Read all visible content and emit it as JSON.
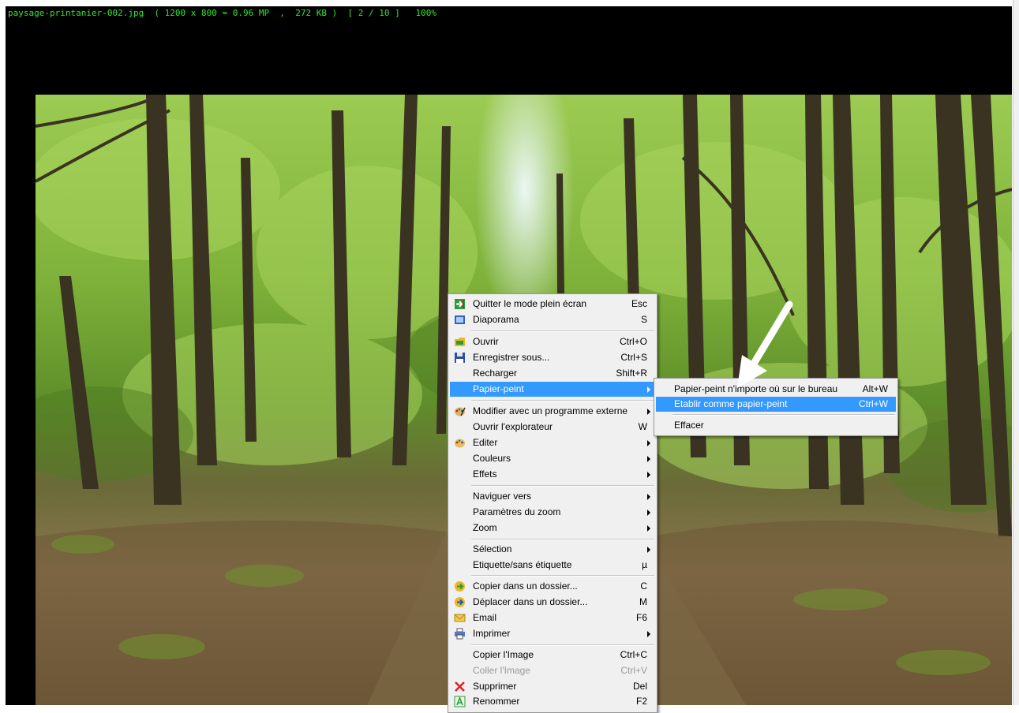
{
  "viewer": {
    "status_line": "paysage-printanier-002.jpg  ( 1200 x 800 = 0.96 MP  ,  272 KB )  [ 2 / 10 ]   100%"
  },
  "context_menu": {
    "items": [
      {
        "label": "Quitter le mode plein écran",
        "shortcut": "Esc",
        "icon": "exit-fullscreen-icon"
      },
      {
        "label": "Diaporama",
        "shortcut": "S",
        "icon": "slideshow-icon"
      },
      {
        "label": "Ouvrir",
        "shortcut": "Ctrl+O",
        "icon": "open-folder-icon"
      },
      {
        "label": "Enregistrer sous...",
        "shortcut": "Ctrl+S",
        "icon": "save-disk-icon"
      },
      {
        "label": "Recharger",
        "shortcut": "Shift+R"
      },
      {
        "label": "Papier-peint",
        "submenu": true,
        "highlighted": true
      },
      {
        "label": "Modifier avec un programme externe",
        "submenu": true,
        "icon": "palette-icon"
      },
      {
        "label": "Ouvrir l'explorateur",
        "shortcut": "W"
      },
      {
        "label": "Editer",
        "submenu": true,
        "icon": "edit-palette-icon"
      },
      {
        "label": "Couleurs",
        "submenu": true
      },
      {
        "label": "Effets",
        "submenu": true
      },
      {
        "label": "Naviguer vers",
        "submenu": true
      },
      {
        "label": "Paramètres du zoom",
        "submenu": true
      },
      {
        "label": "Zoom",
        "submenu": true
      },
      {
        "label": "Sélection",
        "submenu": true
      },
      {
        "label": "Etiquette/sans étiquette",
        "shortcut": "µ"
      },
      {
        "label": "Copier dans un dossier...",
        "shortcut": "C",
        "icon": "copy-to-folder-icon"
      },
      {
        "label": "Déplacer dans un dossier...",
        "shortcut": "M",
        "icon": "move-to-folder-icon"
      },
      {
        "label": "Email",
        "shortcut": "F6",
        "icon": "email-icon"
      },
      {
        "label": "Imprimer",
        "submenu": true,
        "icon": "printer-icon"
      },
      {
        "label": "Copier l'Image",
        "shortcut": "Ctrl+C"
      },
      {
        "label": "Coller l'Image",
        "shortcut": "Ctrl+V",
        "disabled": true
      },
      {
        "label": "Supprimer",
        "shortcut": "Del",
        "icon": "delete-x-icon"
      },
      {
        "label": "Renommer",
        "shortcut": "F2",
        "icon": "rename-icon"
      }
    ]
  },
  "submenu": {
    "items": [
      {
        "label": "Papier-peint n'importe où sur le bureau",
        "shortcut": "Alt+W"
      },
      {
        "label": "Etablir comme papier-peint",
        "shortcut": "Ctrl+W",
        "highlighted": true
      },
      {
        "label": "Effacer"
      }
    ]
  },
  "colors": {
    "highlight": "#3399ff",
    "status_text": "#2ee82e",
    "viewer_background": "#000000"
  }
}
